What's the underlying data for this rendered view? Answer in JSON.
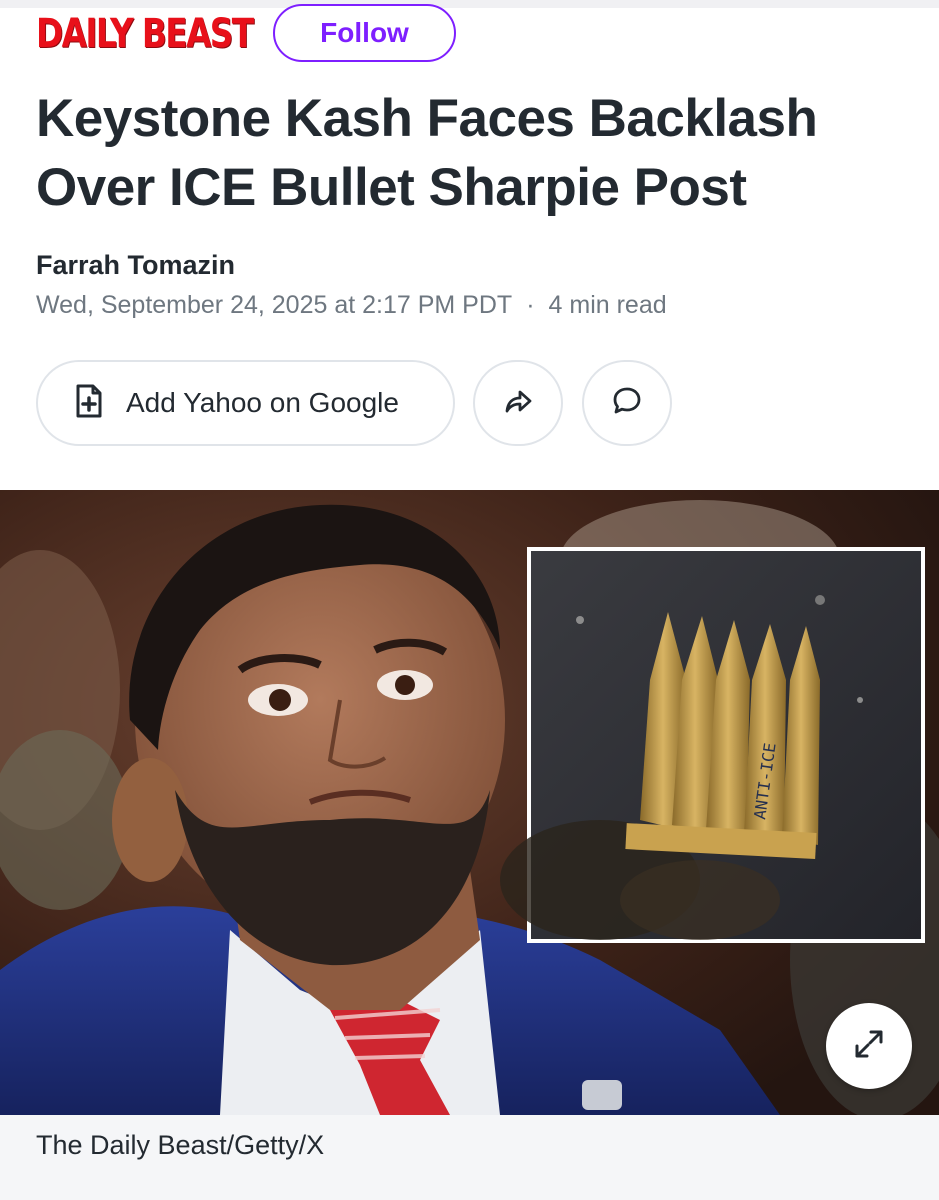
{
  "publisher": {
    "logo_text": "DAILY BEAST",
    "follow_label": "Follow"
  },
  "article": {
    "headline": "Keystone Kash Faces Backlash Over ICE Bullet Sharpie Post",
    "author": "Farrah Tomazin",
    "date": "Wed, September 24, 2025 at 2:17 PM PDT",
    "separator": "·",
    "read_time": "4 min read"
  },
  "actions": {
    "add_google_label": "Add Yahoo on Google",
    "add_google_icon": "document-plus-icon",
    "share_icon": "share-arrow-icon",
    "comment_icon": "comment-bubble-icon"
  },
  "media": {
    "caption": "The Daily Beast/Getty/X",
    "inset_bullet_text": "ANTI-ICE",
    "expand_icon": "expand-arrows-icon"
  },
  "colors": {
    "accent_purple": "#7e1fff",
    "brand_red": "#e8101a",
    "text_primary": "#232a31",
    "text_secondary": "#6e7780"
  }
}
